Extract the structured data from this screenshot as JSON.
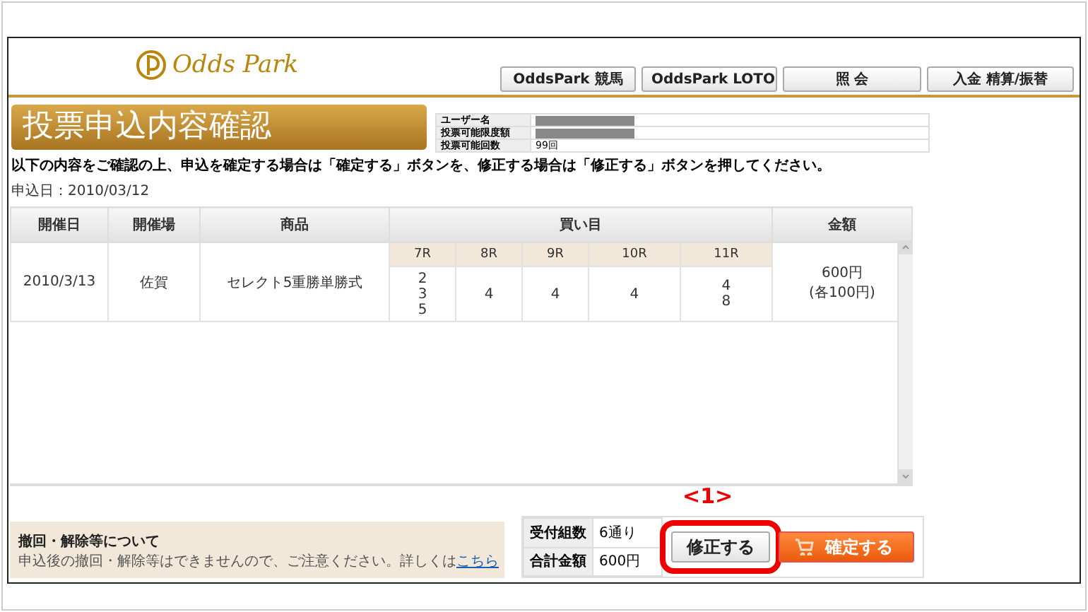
{
  "header": {
    "logo": "Odds Park",
    "nav": [
      {
        "label": "OddsPark 競馬"
      },
      {
        "label": "OddsPark LOTO"
      },
      {
        "label": "照 会"
      },
      {
        "label": "入金 精算/振替"
      }
    ]
  },
  "title": "投票申込内容確認",
  "account": [
    {
      "label": "ユーザー名",
      "masked": true
    },
    {
      "label": "投票可能限度額",
      "masked": true
    },
    {
      "label": "投票可能回数",
      "masked": false,
      "value": "99回"
    }
  ],
  "instruction": "以下の内容をご確認の上、申込を確定する場合は「確定する」ボタンを、修正する場合は「修正する」ボタンを押してください。",
  "apply_date": "申込日：2010/03/12",
  "table": {
    "columns": [
      "開催日",
      "開催場",
      "商品",
      "買い目",
      "金額"
    ],
    "races": [
      "7R",
      "8R",
      "9R",
      "10R",
      "11R"
    ],
    "rows": [
      {
        "date": "2010/3/13",
        "venue": "佐賀",
        "product": "セレクト5重勝単勝式",
        "picks": [
          [
            "2",
            "3",
            "5"
          ],
          [
            "4"
          ],
          [
            "4"
          ],
          [
            "4"
          ],
          [
            "4",
            "8"
          ]
        ],
        "amount": [
          "600円",
          "(各100円)"
        ]
      }
    ]
  },
  "notice": {
    "title": "撤回・解除等について",
    "text": "申込後の撤回・解除等はできませんので、ご注意ください。詳しくは",
    "link": "こちら"
  },
  "summary": [
    {
      "label": "受付組数",
      "value": "6通り"
    },
    {
      "label": "合計金額",
      "value": "600円"
    }
  ],
  "annotation": "<1>",
  "buttons": [
    {
      "label": "修正する",
      "kind": "plain",
      "highlighted": true
    },
    {
      "label": "確定する",
      "kind": "primary",
      "highlighted": false
    }
  ]
}
